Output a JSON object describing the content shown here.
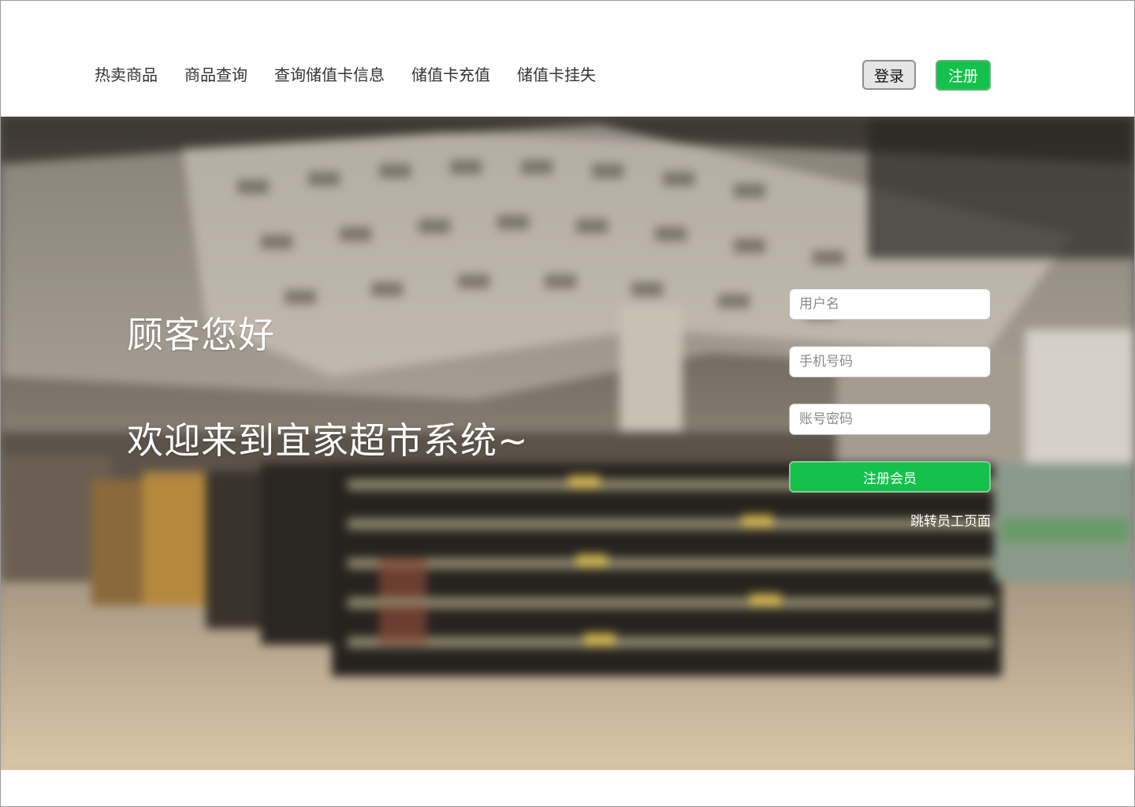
{
  "nav": {
    "items": [
      {
        "label": "热卖商品"
      },
      {
        "label": "商品查询"
      },
      {
        "label": "查询储值卡信息"
      },
      {
        "label": "储值卡充值"
      },
      {
        "label": "储值卡挂失"
      }
    ],
    "login_label": "登录",
    "register_label": "注册"
  },
  "hero": {
    "greeting": "顾客您好",
    "welcome": "欢迎来到宜家超市系统~"
  },
  "form": {
    "username_placeholder": "用户名",
    "phone_placeholder": "手机号码",
    "password_placeholder": "账号密码",
    "submit_label": "注册会员",
    "staff_link": "跳转员工页面"
  },
  "colors": {
    "accent_green": "#13c14b",
    "login_bg": "#e5e5e5"
  }
}
